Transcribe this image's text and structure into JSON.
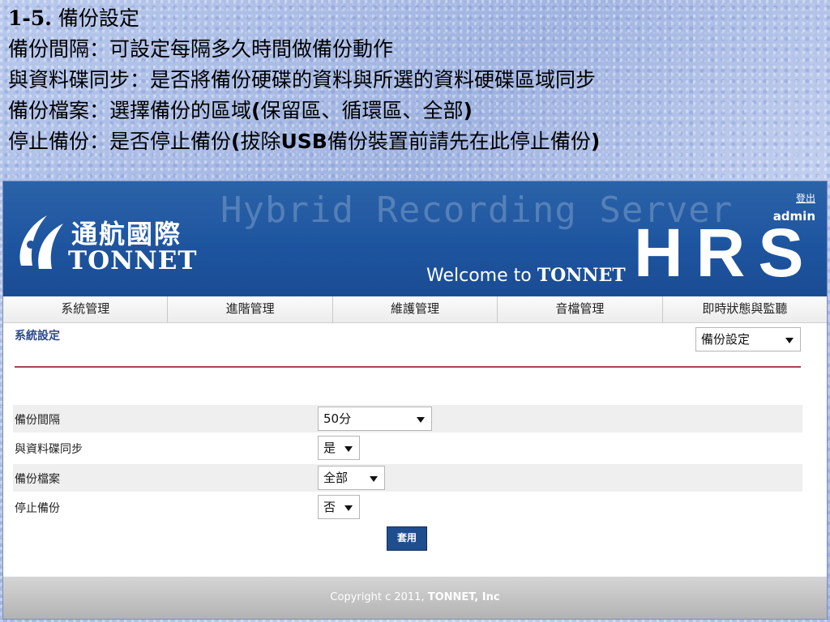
{
  "slide": {
    "title_num": "1-5.",
    "title_text": "備份設定",
    "line1": "備份間隔：可設定每隔多久時間做備份動作",
    "line2": "與資料碟同步：是否將備份硬碟的資料與所選的資料硬碟區域同步",
    "line3_a": "備份檔案：選擇備份的區域",
    "line3_b": "(",
    "line3_c": "保留區、循環區、全部",
    "line3_d": ")",
    "line4_a": "停止備份：是否停止備份",
    "line4_b": "(",
    "line4_c": "拔除",
    "line4_d": "USB",
    "line4_e": "備份裝置前請先在此停止備份",
    "line4_f": ")"
  },
  "header": {
    "bg_title": "Hybrid Recording Server",
    "logo_cn": "通航國際",
    "logo_en": "TONNET",
    "welcome_prefix": "Welcome to ",
    "welcome_brand": "TONNET",
    "hrs": "HRS",
    "logout": "登出",
    "user": "admin"
  },
  "nav": {
    "items": [
      "系統管理",
      "進階管理",
      "維護管理",
      "音檔管理",
      "即時狀態與監聽"
    ]
  },
  "page": {
    "section_title": "系統設定",
    "setting_select": "備份設定"
  },
  "form": {
    "rows": [
      {
        "label": "備份間隔",
        "value": "50分"
      },
      {
        "label": "與資料碟同步",
        "value": "是"
      },
      {
        "label": "備份檔案",
        "value": "全部"
      },
      {
        "label": "停止備份",
        "value": "否"
      }
    ],
    "apply_label": "套用"
  },
  "footer": {
    "copyright_prefix": "Copyright c 2011, ",
    "company": "TONNET, Inc"
  },
  "colors": {
    "banner": "#1e55a0",
    "divider": "#a5444c",
    "button": "#1f4e8f"
  }
}
